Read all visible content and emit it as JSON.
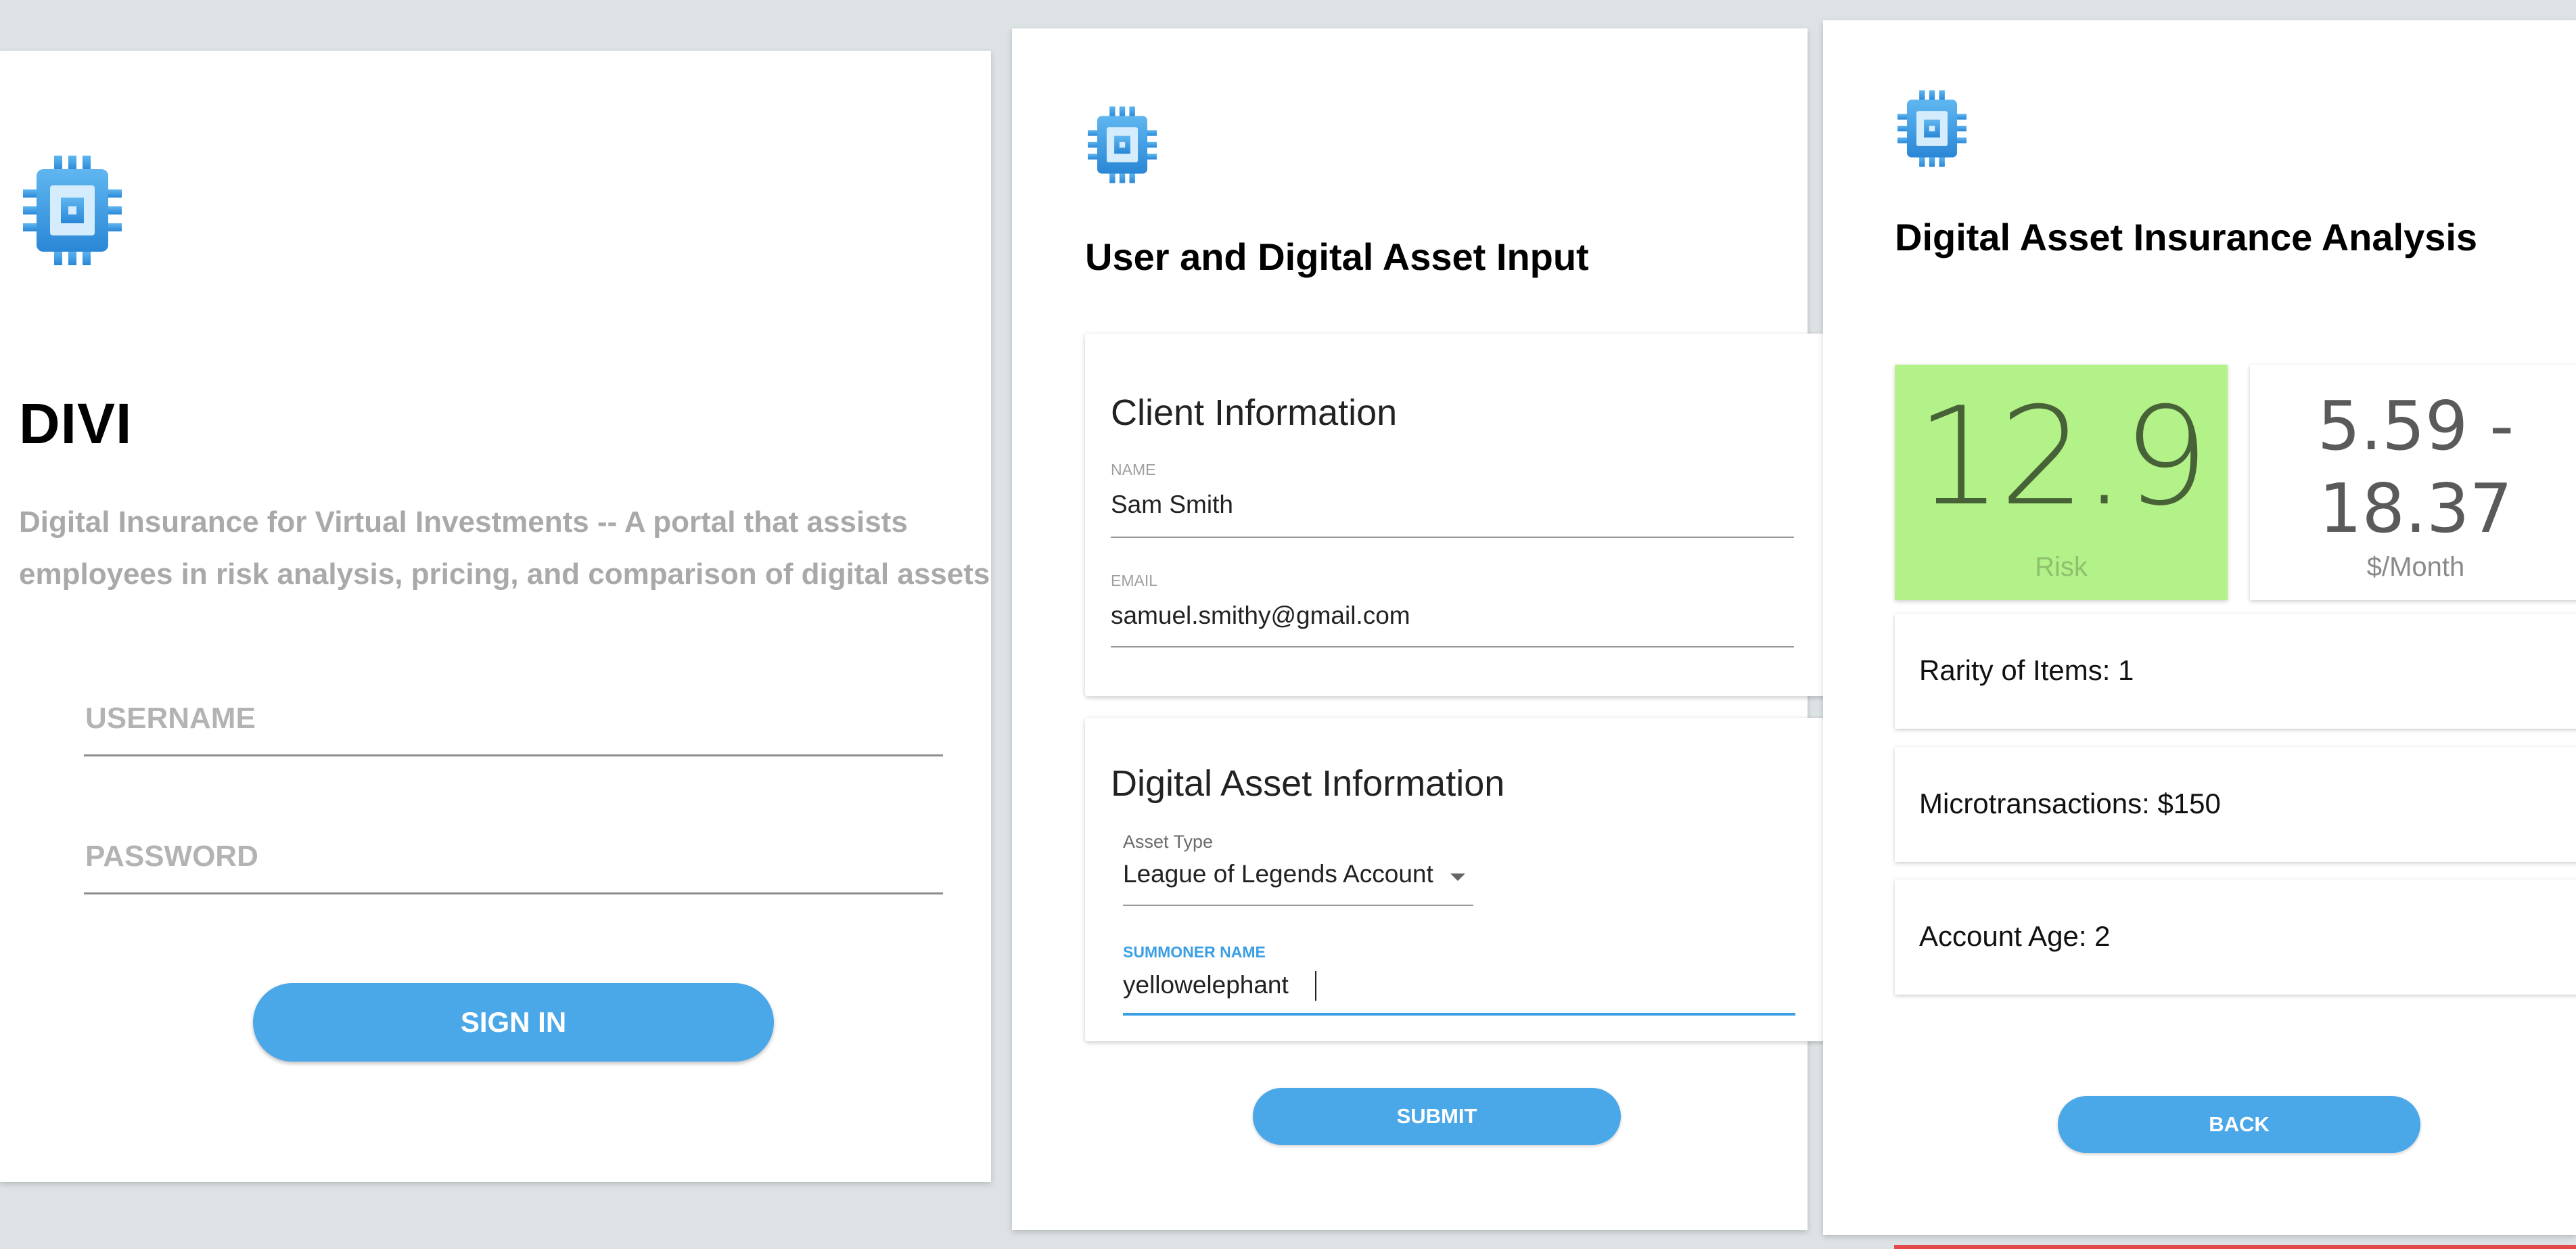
{
  "colors": {
    "background": "#dde2e5",
    "primary_button": "#4aa7e8",
    "risk_tile": "#b3f288",
    "focus_underline": "#3a9ee4",
    "alert_bar": "#e34b4b"
  },
  "login": {
    "logo_icon": "chip-icon",
    "brand": "DIVI",
    "description_line1": "Digital Insurance for Virtual Investments -- A portal that assists",
    "description_line2": "employees in risk analysis, pricing, and comparison of digital assets",
    "username_placeholder": "USERNAME",
    "password_placeholder": "PASSWORD",
    "sign_in_label": "SIGN IN"
  },
  "input_form": {
    "logo_icon": "chip-icon",
    "heading": "User and Digital Asset Input",
    "client_card": {
      "title": "Client Information",
      "name_label": "NAME",
      "name_value": "Sam Smith",
      "email_label": "EMAIL",
      "email_value": "samuel.smithy@gmail.com"
    },
    "asset_card": {
      "title": "Digital Asset Information",
      "asset_type_label": "Asset Type",
      "asset_type_value": "League of Legends Account",
      "summoner_label": "SUMMONER NAME",
      "summoner_value": "yellowelephant"
    },
    "submit_label": "SUBMIT"
  },
  "analysis": {
    "logo_icon": "chip-icon",
    "heading": "Digital Asset Insurance Analysis",
    "risk_value": "12.9",
    "risk_caption": "Risk",
    "price_range_line1": "5.59 -",
    "price_range_line2": "18.37",
    "price_caption": "$/Month",
    "stats": [
      "Rarity of Items: 1",
      "Microtransactions: $150",
      "Account Age: 2"
    ],
    "back_label": "BACK"
  }
}
